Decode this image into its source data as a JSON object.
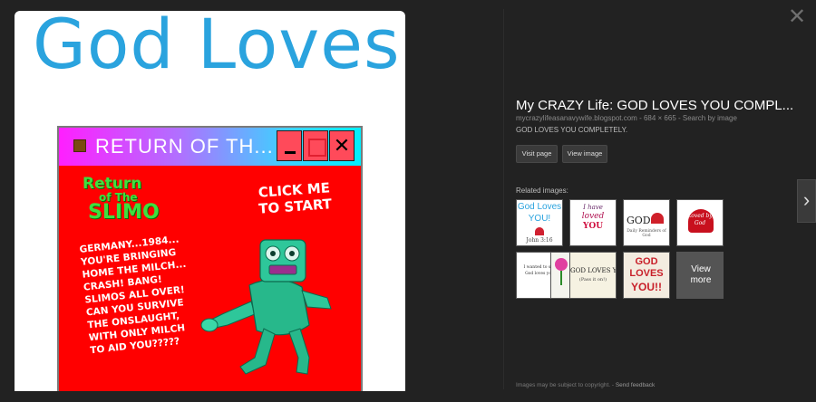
{
  "preview": {
    "heading": "God Loves",
    "game_window": {
      "title": "RETURN OF TH...",
      "min_label": "_",
      "close_label": "✕",
      "logo": [
        "Return",
        "of The",
        "SLIMO"
      ],
      "click_to_start": [
        "CLICK ME",
        "TO START"
      ],
      "story_lines": [
        "GERMANY...1984...",
        "YOU'RE BRINGING",
        "HOME THE MILCH...",
        "CRASH! BANG!",
        "SLIMOS ALL OVER!",
        "CAN YOU SURVIVE",
        "THE ONSLAUGHT,",
        "WITH ONLY MILCH",
        "TO AID YOU?????"
      ]
    }
  },
  "info": {
    "close_icon": "close-icon",
    "title": "My CRAZY Life: GOD LOVES YOU COMPL...",
    "meta": {
      "domain": "mycrazylifeasanavywife.blogspot.com",
      "sep1": " - ",
      "dimensions": "684 × 665",
      "sep2": " - ",
      "search_by_image": "Search by image"
    },
    "description": "GOD LOVES YOU COMPLETELY.",
    "visit_page": "Visit page",
    "view_image": "View image",
    "related_label": "Related images:",
    "related": [
      {
        "line1": "God Loves",
        "line2": "YOU!",
        "line3": "John 3:16"
      },
      {
        "line1": "I have",
        "line2": "loved",
        "line3": "YOU"
      },
      {
        "line1": "GOD",
        "line2": "Daily Reminders of God",
        "line3": ""
      },
      {
        "line1": "Loved by",
        "line2": "God",
        "line3": ""
      },
      {
        "line1": "I wanted to say",
        "line2": "God loves you",
        "line3": ""
      },
      {
        "line1": "",
        "line2": "",
        "line3": ""
      },
      {
        "line1": "GOD LOVES Y",
        "line2": "(Pass it on!)",
        "line3": ""
      },
      {
        "line1": "GOD",
        "line2": "LOVES",
        "line3": "YOU!!"
      }
    ],
    "view_more": [
      "View",
      "more"
    ],
    "next_icon": "chevron-right-icon",
    "footer_text": "Images may be subject to copyright.",
    "footer_sep": " - ",
    "footer_link": "Send feedback"
  },
  "colors": {
    "background": "#222222",
    "heading_blue": "#2aa3de",
    "game_red": "#ff0000",
    "slimo_green": "#3ee03e"
  }
}
